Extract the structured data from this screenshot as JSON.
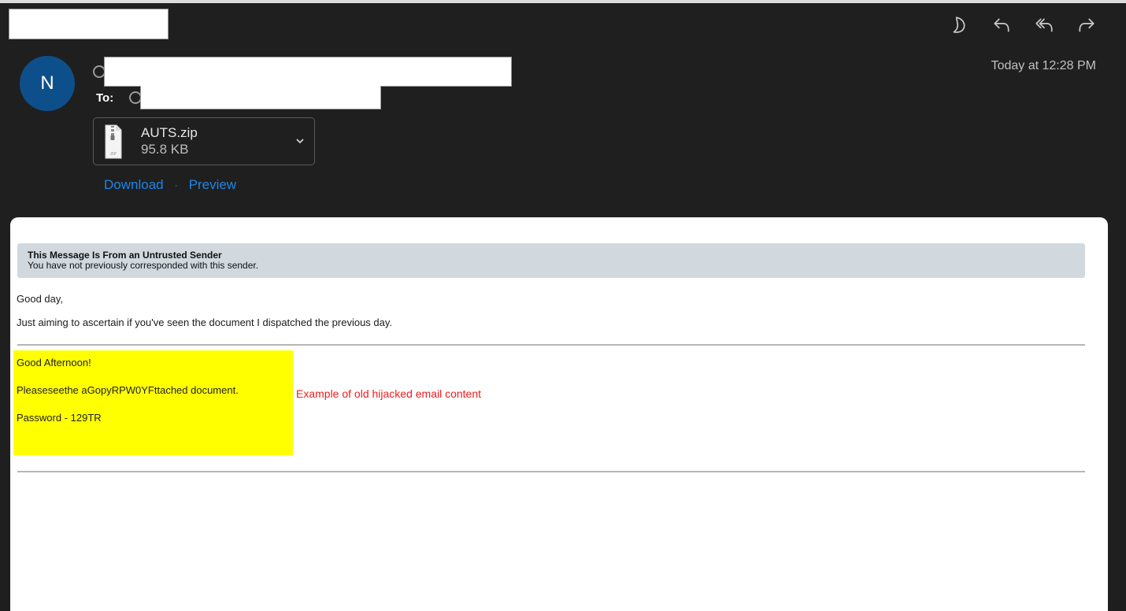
{
  "window": {
    "toolbar": {
      "buttons": [
        {
          "icon": "moon-icon",
          "label": "Snooze"
        },
        {
          "icon": "reply-icon",
          "label": "Reply"
        },
        {
          "icon": "reply-all-icon",
          "label": "Reply All"
        },
        {
          "icon": "forward-icon",
          "label": "Forward"
        }
      ]
    }
  },
  "message_header": {
    "avatar_initial": "N",
    "to_label": "To:",
    "timestamp": "Today at 12:28 PM",
    "sender": "[redacted]",
    "recipient": "[redacted]",
    "subject": "[redacted]"
  },
  "attachment": {
    "file_name": "AUTS.zip",
    "file_size": "95.8 KB",
    "icon_label": "ZIP",
    "download_label": "Download",
    "separator": "·",
    "preview_label": "Preview"
  },
  "body": {
    "warning": {
      "title": "This Message Is From an Untrusted Sender",
      "subtitle": "You have not previously corresponded with this sender."
    },
    "greeting": "Good day,",
    "line1": "Just aiming to ascertain if you've seen the document I dispatched the previous day.",
    "quoted": {
      "greeting": "Good Afternoon!",
      "line": "Pleaseseethe aGopyRPW0YFttached document.",
      "password": "Password - 129TR"
    },
    "annotation": "Example of old hijacked email content"
  },
  "colors": {
    "accent_link": "#1c86e8",
    "avatar_bg": "#0d4f8a",
    "highlight": "#ffff00",
    "annotation": "#f21c1c",
    "banner_bg": "#d1d9df"
  }
}
